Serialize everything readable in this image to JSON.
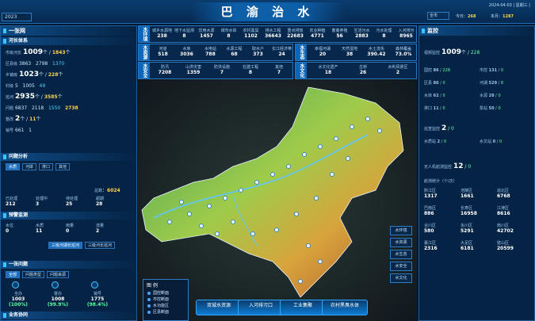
{
  "header": {
    "title": "巴 渝 治 水",
    "left_select": "2023",
    "date": "2024-04-03 | 星期三 |",
    "right_select": "全市",
    "stats": [
      {
        "label": "今日",
        "value": "268"
      },
      {
        "label": "本月",
        "value": "1287"
      }
    ]
  },
  "left": {
    "panel_title": "一张网",
    "section_title": "河长体系",
    "rows": [
      {
        "label": "市级河长",
        "value": "1009",
        "unit": "个",
        "extra": "1843",
        "extra_unit": "个"
      },
      {
        "label": "区县级",
        "value": "3863",
        "unit": "",
        "extra": "2798",
        "extra_unit": "",
        "note": "1370"
      },
      {
        "label": "乡镇级",
        "value": "1023",
        "unit": "个",
        "extra": "228",
        "extra_unit": "个"
      },
      {
        "label": "村级",
        "value": "5",
        "unit": "",
        "extra": "1005",
        "extra_unit": "",
        "note": "49"
      },
      {
        "label": "巡河",
        "value": "2935",
        "unit": "个",
        "extra": "3585",
        "extra_unit": "个"
      },
      {
        "label": "问题",
        "value": "6837",
        "unit": "",
        "extra": "2118",
        "extra_unit": "",
        "note": "1550",
        "note2": "2738"
      },
      {
        "label": "整改",
        "value": "2",
        "unit": "个",
        "extra": "11",
        "extra_unit": "个"
      },
      {
        "label": "销号",
        "value": "661",
        "unit": "",
        "extra": "1",
        "extra_unit": ""
      }
    ],
    "analysis_title": "问题分析",
    "analysis_tabs": [
      "水质",
      "河岸",
      "排口",
      "其他"
    ],
    "analysis_total_label": "总数",
    "analysis_total": "6024",
    "analysis_cells": [
      {
        "label": "已处理",
        "value": "212"
      },
      {
        "label": "处理中",
        "value": "3"
      },
      {
        "label": "待处理",
        "value": "25"
      },
      {
        "label": "超期",
        "value": "28"
      }
    ],
    "warning_title": "预警监测",
    "warning_cells": [
      {
        "label": "水位",
        "value": "0"
      },
      {
        "label": "水质",
        "value": "11"
      },
      {
        "label": "雨量",
        "value": "0"
      },
      {
        "label": "流量",
        "value": "2"
      }
    ],
    "tabs2": [
      "三级河湖长巡河",
      "三级河长巡河"
    ],
    "patrol_title": "一张问题",
    "patrol_tabs": [
      "全部",
      "问题类型",
      "问题来源"
    ],
    "progress": [
      {
        "label": "全办",
        "value": "1003",
        "pct": "(100%)"
      },
      {
        "label": "督办",
        "value": "1008",
        "pct": "(99.9%)"
      },
      {
        "label": "销号",
        "value": "1775",
        "pct": "(98.4%)"
      }
    ],
    "progress_fraction": [
      1.0,
      0.999,
      0.984
    ],
    "footer_title": "业务协同"
  },
  "strip": {
    "blocks": [
      {
        "label": "水环境",
        "cells": [
          {
            "name": "城乡水源地",
            "value": "238"
          },
          {
            "name": "地下水监测",
            "value": "8"
          },
          {
            "name": "饮用水源",
            "value": "1457"
          },
          {
            "name": "城市水体",
            "value": "8"
          },
          {
            "name": "农村黑臭",
            "value": "1102"
          },
          {
            "name": "排水工程",
            "value": "36643"
          },
          {
            "name": "重点排放",
            "value": "22683"
          },
          {
            "name": "农业种植",
            "value": "4771"
          },
          {
            "name": "畜禽养殖",
            "value": "56"
          },
          {
            "name": "生活污水",
            "value": "2883"
          },
          {
            "name": "污水处理",
            "value": "8"
          },
          {
            "name": "入河排污",
            "value": "8965"
          }
        ]
      },
      {
        "label": "水资源",
        "cells": [
          {
            "name": "河道",
            "value": "518"
          },
          {
            "name": "水库",
            "value": "3036"
          },
          {
            "name": "水电站",
            "value": "788"
          },
          {
            "name": "水源工程",
            "value": "68"
          },
          {
            "name": "取水户",
            "value": "373"
          },
          {
            "name": "长江经济带",
            "value": "24"
          }
        ]
      },
      {
        "label": "水生态",
        "cells": [
          {
            "name": "幸福河湖",
            "value": "20"
          },
          {
            "name": "天然湿地",
            "value": "38"
          },
          {
            "name": "水土流失",
            "value": "390.42"
          },
          {
            "name": "森林覆盖",
            "value": "73.0%"
          }
        ]
      },
      {
        "label": "水安全",
        "cells": [
          {
            "name": "防汛",
            "value": "7208"
          },
          {
            "name": "山洪灾害",
            "value": "1359"
          },
          {
            "name": "防洪设施",
            "value": "7"
          },
          {
            "name": "在建工程",
            "value": "8"
          },
          {
            "name": "其他",
            "value": "7"
          }
        ]
      },
      {
        "label": "水文化",
        "cells": [
          {
            "name": "水文化遗产",
            "value": "18"
          },
          {
            "name": "古桥",
            "value": "26"
          },
          {
            "name": "水利风景区",
            "value": "2"
          }
        ]
      }
    ]
  },
  "legend": {
    "title": "图 例",
    "items": [
      "国控断面",
      "市控断面",
      "水功能区",
      "区县断面"
    ]
  },
  "map_side_buttons": [
    "水环境",
    "水资源",
    "水生态",
    "水安全",
    "水文化"
  ],
  "bottom_buttons": [
    "双城水资源",
    "入河排污口",
    "工业集聚",
    "农村黑臭水体"
  ],
  "right": {
    "panel_title": "监控",
    "video_label": "视频监控",
    "video_value": "1009",
    "video_unit": "个",
    "video_extra": "228",
    "video_rows": [
      {
        "name": "国控",
        "value": "86",
        "extra": "228"
      },
      {
        "name": "市控",
        "value": "131",
        "extra": "0"
      },
      {
        "name": "区县",
        "value": "86",
        "extra": "0"
      },
      {
        "name": "河湖",
        "value": "529",
        "extra": "8"
      },
      {
        "name": "水库",
        "value": "62",
        "extra": "0"
      },
      {
        "name": "水源",
        "value": "28",
        "extra": "0"
      },
      {
        "name": "排口",
        "value": "11",
        "extra": "0"
      },
      {
        "name": "泵站",
        "value": "50",
        "extra": "0"
      }
    ],
    "patrol_label": "巡查监控",
    "patrol_value": "2",
    "patrol_extra": "0",
    "patrol_rows": [
      {
        "name": "水质站",
        "value": "2",
        "extra": "0"
      },
      {
        "name": "水文站",
        "value": "0",
        "extra": "0"
      }
    ],
    "uav_label": "无人机航测监控",
    "uav_value": "12",
    "uav_extra": "0",
    "uav_subtitle": "航测统计（个/次）",
    "uav_cells": [
      {
        "name": "黔江区",
        "value": "1317"
      },
      {
        "name": "涪陵区",
        "value": "1661"
      },
      {
        "name": "渝北区",
        "value": "6768"
      },
      {
        "name": "巴南区",
        "value": "886"
      },
      {
        "name": "长寿区",
        "value": "16958"
      },
      {
        "name": "江津区",
        "value": "8616"
      },
      {
        "name": "合川区",
        "value": "580"
      },
      {
        "name": "永川区",
        "value": "5291"
      },
      {
        "name": "南川区",
        "value": "42702"
      },
      {
        "name": "綦江区",
        "value": "2316"
      },
      {
        "name": "大足区",
        "value": "6181"
      },
      {
        "name": "璧山区",
        "value": "20599"
      }
    ]
  }
}
